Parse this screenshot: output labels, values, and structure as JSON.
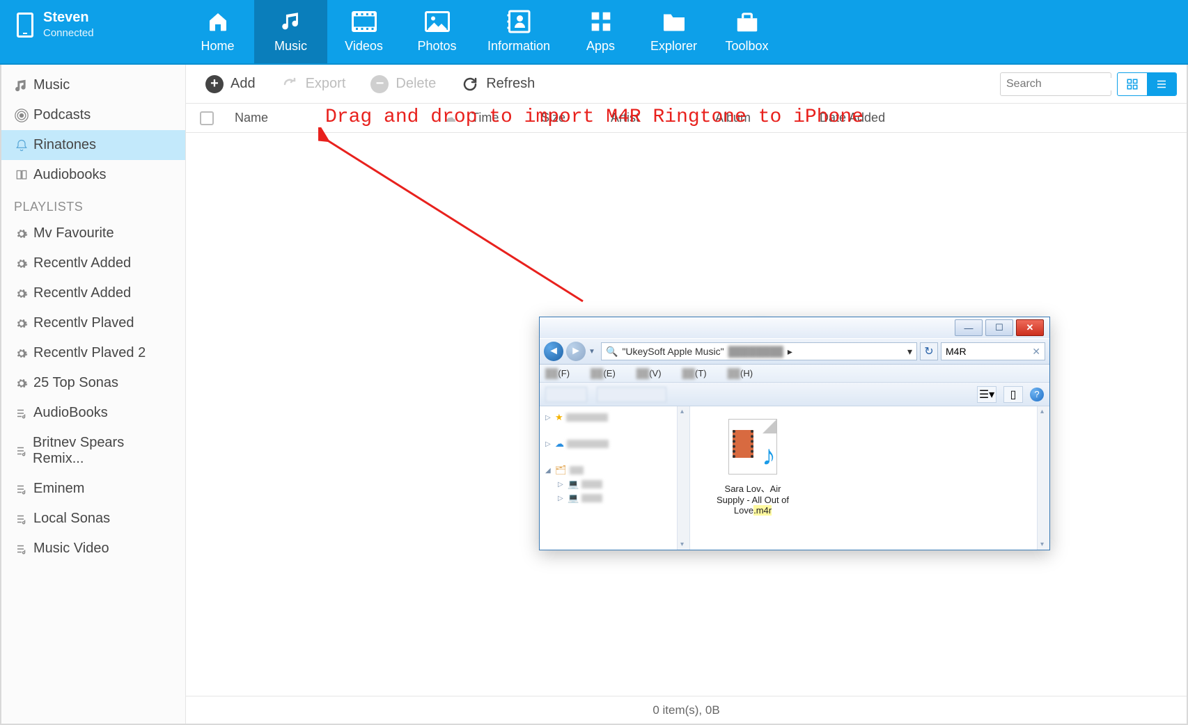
{
  "device": {
    "name": "Steven",
    "status": "Connected"
  },
  "nav": {
    "home": "Home",
    "music": "Music",
    "videos": "Videos",
    "photos": "Photos",
    "information": "Information",
    "apps": "Apps",
    "explorer": "Explorer",
    "toolbox": "Toolbox"
  },
  "sidebar": {
    "library": [
      {
        "label": "Music"
      },
      {
        "label": "Podcasts"
      },
      {
        "label": "Rinatones"
      },
      {
        "label": "Audiobooks"
      }
    ],
    "playlists_header": "PLAYLISTS",
    "playlists": [
      {
        "label": "Mv Favourite"
      },
      {
        "label": "Recentlv Added"
      },
      {
        "label": "Recentlv Added"
      },
      {
        "label": "Recentlv Plaved"
      },
      {
        "label": "Recentlv Plaved 2"
      },
      {
        "label": "25 Top Sonas"
      },
      {
        "label": "AudioBooks"
      },
      {
        "label": "Britnev Spears Remix..."
      },
      {
        "label": "Eminem"
      },
      {
        "label": "Local Sonas"
      },
      {
        "label": "Music Video"
      }
    ]
  },
  "toolbar": {
    "add": "Add",
    "export": "Export",
    "delete": "Delete",
    "refresh": "Refresh",
    "search_placeholder": "Search"
  },
  "columns": {
    "name": "Name",
    "time": "Time",
    "size": "Size",
    "artist": "Artist",
    "album": "Album",
    "date_added": "Date Added"
  },
  "annotation": "Drag and drop to import M4R Ringtone to iPhone",
  "status": "0 item(s), 0B",
  "explorer": {
    "path_label": "\"UkeySoft Apple Music\"",
    "filter": "M4R",
    "menu_letters": [
      "(F)",
      "(E)",
      "(V)",
      "(T)",
      "(H)"
    ],
    "file": {
      "name_pre": "Sara Lov、Air Supply - All Out of Love",
      "ext": ".m4r"
    }
  }
}
